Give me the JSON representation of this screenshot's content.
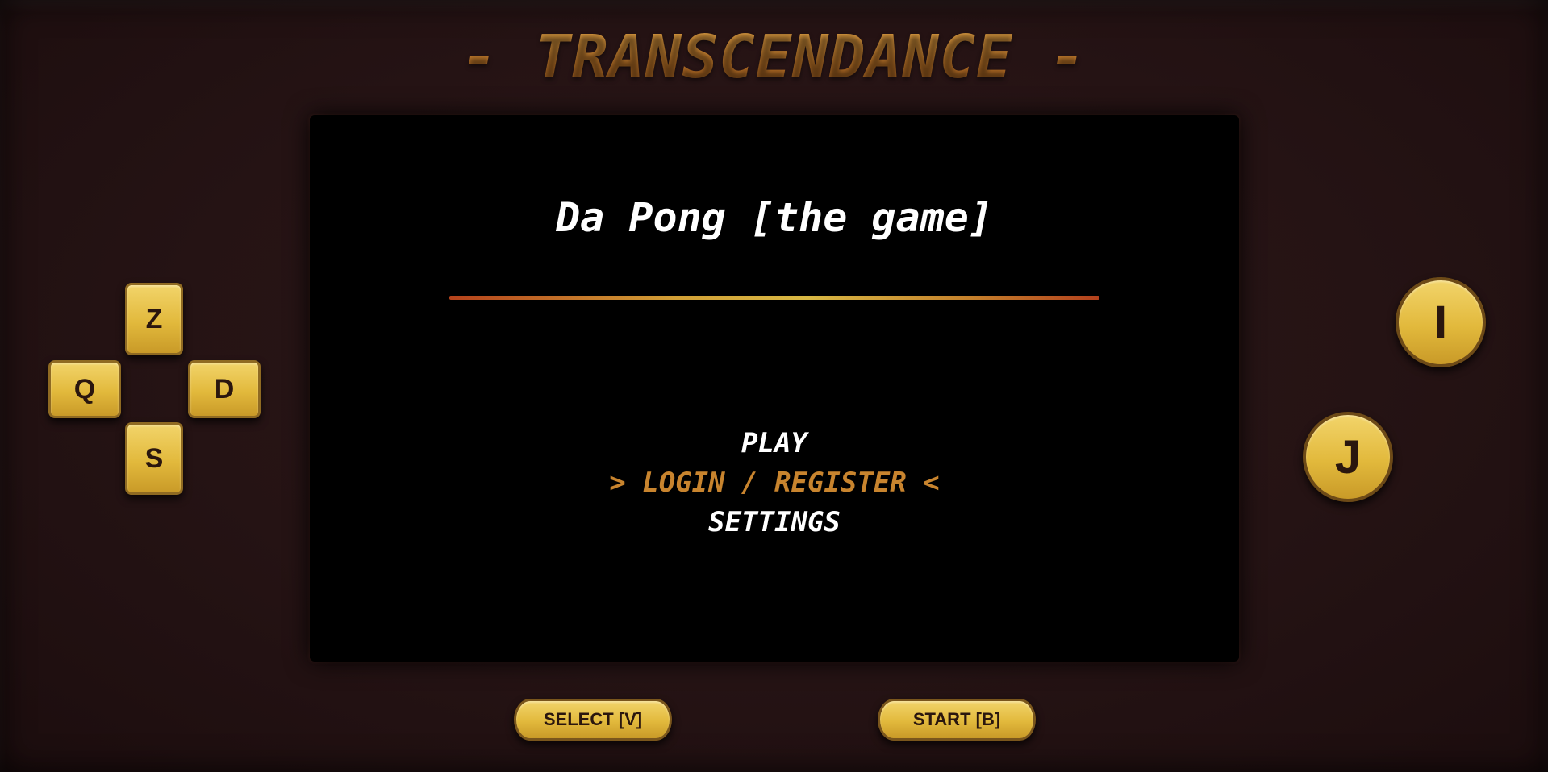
{
  "header": {
    "title": "- TRANSCENDANCE -"
  },
  "screen": {
    "game_title": "Da Pong [the game]",
    "menu": [
      {
        "label": "PLAY",
        "selected": false
      },
      {
        "label": "> LOGIN / REGISTER <",
        "selected": true
      },
      {
        "label": "SETTINGS",
        "selected": false
      }
    ]
  },
  "controls": {
    "dpad": {
      "up": "Z",
      "left": "Q",
      "right": "D",
      "down": "S"
    },
    "action_buttons": {
      "top": "I",
      "bottom": "J"
    },
    "select_label": "SELECT [V]",
    "start_label": "START [B]"
  },
  "colors": {
    "body": "#241213",
    "accent_gold": "#e2b93c",
    "title_orange": "#c98a32",
    "selected_item": "#c8842e",
    "screen": "#000000"
  }
}
